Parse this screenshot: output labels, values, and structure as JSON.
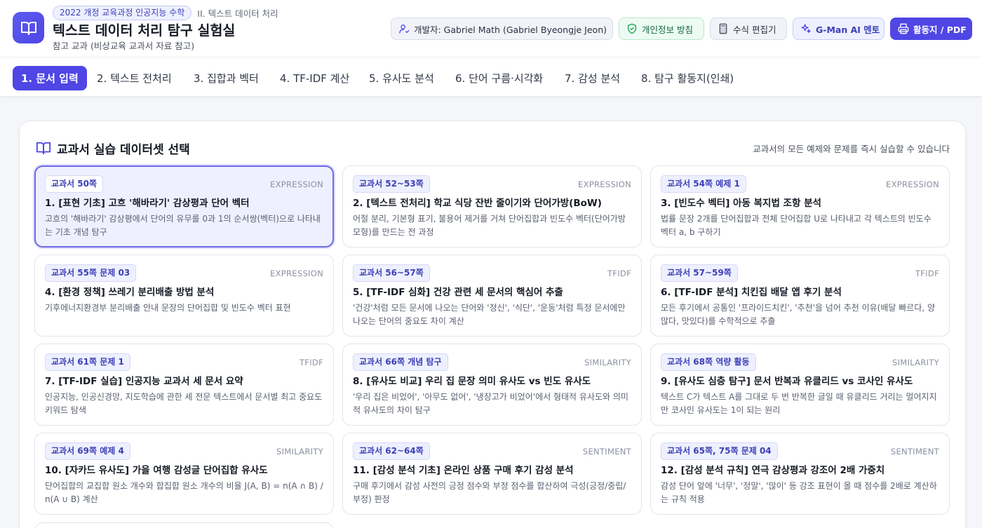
{
  "header": {
    "curriculum_badge": "2022 개정 교육과정 인공지능 수학",
    "unit_label": "II. 텍스트 데이터 처리",
    "title": "텍스트 데이터 처리 탐구 실험실",
    "subtitle": "참고 교과 (비상교육 교과서 자료 참고)",
    "buttons": {
      "developer": "개발자: Gabriel Math (Gabriel Byeongje Jeon)",
      "privacy": "개인정보 방침",
      "formula": "수식 편집기",
      "mentor": "G-Man AI 멘토",
      "pdf": "활동지 / PDF"
    },
    "colors": {
      "accent": "#4f46e5",
      "privacy_green": "#16693f"
    }
  },
  "tabs": [
    {
      "label": "1. 문서 입력",
      "active": true
    },
    {
      "label": "2. 텍스트 전처리"
    },
    {
      "label": "3. 집합과 벡터"
    },
    {
      "label": "4. TF-IDF 계산"
    },
    {
      "label": "5. 유사도 분석"
    },
    {
      "label": "6. 단어 구름·시각화"
    },
    {
      "label": "7. 감성 분석"
    },
    {
      "label": "8. 탐구 활동지(인쇄)"
    }
  ],
  "panel": {
    "title": "교과서 실습 데이터셋 선택",
    "note": "교과서의 모든 예제와 문제를 즉시 실습할 수 있습니다",
    "icon": "book-open-icon"
  },
  "datasets": [
    {
      "page": "교과서 50쪽",
      "type": "EXPRESSION",
      "title": "1. [표현 기초] 고흐 '해바라기' 감상평과 단어 벡터",
      "desc": "고흐의 '해바라기' 감상평에서 단어의 유무를 0과 1의 순서쌍(벡터)으로 나타내는 기초 개념 탐구",
      "selected": true
    },
    {
      "page": "교과서 52~53쪽",
      "type": "EXPRESSION",
      "title": "2. [텍스트 전처리] 학교 식당 잔반 줄이기와 단어가방(BoW)",
      "desc": "어절 분리, 기본형 표기, 불용어 제거를 거쳐 단어집합과 빈도수 벡터(단어가방 모형)를 만드는 전 과정"
    },
    {
      "page": "교과서 54쪽 예제 1",
      "type": "EXPRESSION",
      "title": "3. [빈도수 벡터] 아동 복지법 조항 분석",
      "desc": "법률 문장 2개를 단어집합과 전체 단어집합 U로 나타내고 각 텍스트의 빈도수 벡터 a, b 구하기"
    },
    {
      "page": "교과서 55쪽 문제 03",
      "type": "EXPRESSION",
      "title": "4. [환경 정책] 쓰레기 분리배출 방법 분석",
      "desc": "기후에너지환경부 분리배출 안내 문장의 단어집합 및 빈도수 벡터 표현"
    },
    {
      "page": "교과서 56~57쪽",
      "type": "TFIDF",
      "title": "5. [TF-IDF 심화] 건강 관련 세 문서의 핵심어 추출",
      "desc": "'건강'처럼 모든 문서에 나오는 단어와 '정신', '식단', '운동'처럼 특정 문서에만 나오는 단어의 중요도 차이 계산"
    },
    {
      "page": "교과서 57~59쪽",
      "type": "TFIDF",
      "title": "6. [TF-IDF 분석] 치킨집 배달 앱 후기 분석",
      "desc": "모든 후기에서 공통인 '프라이드치킨', '추천'을 넘어 추천 이유(배달 빠르다, 양 많다, 맛있다)를 수학적으로 추출"
    },
    {
      "page": "교과서 61쪽 문제 1",
      "type": "TFIDF",
      "title": "7. [TF-IDF 실습] 인공지능 교과서 세 문서 요약",
      "desc": "인공지능, 인공신경망, 지도학습에 관한 세 전문 텍스트에서 문서별 최고 중요도 키워드 탐색"
    },
    {
      "page": "교과서 66쪽 개념 탐구",
      "type": "SIMILARITY",
      "title": "8. [유사도 비교] 우리 집 문장 의미 유사도 vs 빈도 유사도",
      "desc": "'우리 집은 비었어', '아무도 없어', '냉장고가 비었어'에서 형태적 유사도와 의미적 유사도의 차이 탐구"
    },
    {
      "page": "교과서 68쪽 역량 활동",
      "type": "SIMILARITY",
      "title": "9. [유사도 심층 탐구] 문서 반복과 유클리드 vs 코사인 유사도",
      "desc": "텍스트 C가 텍스트 A를 그대로 두 번 반복한 글일 때 유클리드 거리는 멀어지지만 코사인 유사도는 1이 되는 원리"
    },
    {
      "page": "교과서 69쪽 예제 4",
      "type": "SIMILARITY",
      "title": "10. [자카드 유사도] 가을 여행 감성글 단어집합 유사도",
      "desc": "단어집합의 교집합 원소 개수와 합집합 원소 개수의 비율 J(A, B) = n(A ∩ B) / n(A ∪ B) 계산"
    },
    {
      "page": "교과서 62~64쪽",
      "type": "SENTIMENT",
      "title": "11. [감성 분석 기초] 온라인 상품 구매 후기 감성 분석",
      "desc": "구매 후기에서 감성 사전의 긍정 점수와 부정 점수를 합산하여 극성(긍정/중립/부정) 판정"
    },
    {
      "page": "교과서 65쪽, 75쪽 문제 04",
      "type": "SENTIMENT",
      "title": "12. [감성 분석 규칙] 연극 감상평과 강조어 2배 가중치",
      "desc": "감성 단어 앞에 '너무', '정말', '많이' 등 강조 표현이 올 때 점수를 2배로 계산하는 규칙 적용"
    }
  ]
}
